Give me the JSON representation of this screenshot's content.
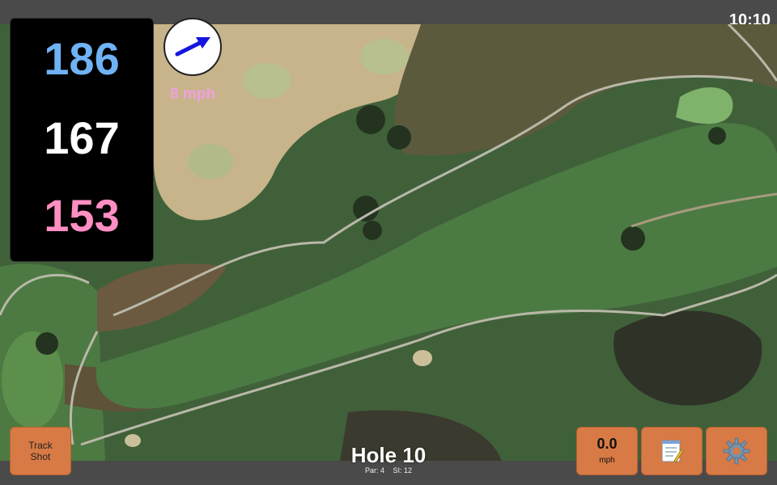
{
  "clock": "10:10",
  "distances": {
    "back": "186",
    "center": "167",
    "front": "153"
  },
  "wind": {
    "speed_label": "8 mph",
    "direction_icon": "arrow-icon",
    "arrow_color": "#1515e0"
  },
  "hole": {
    "title": "Hole 10",
    "par_label": "Par: 4",
    "si_label": "SI: 12"
  },
  "buttons": {
    "track_shot_line1": "Track",
    "track_shot_line2": "Shot",
    "speed_value": "0.0",
    "speed_unit": "mph",
    "notes_icon": "notepad-icon",
    "settings_icon": "gear-icon"
  },
  "colors": {
    "back": "#6fb3f5",
    "center": "#ffffff",
    "front": "#ff8ec3",
    "button": "#d77a45",
    "wind_label": "#f0a0e0"
  }
}
